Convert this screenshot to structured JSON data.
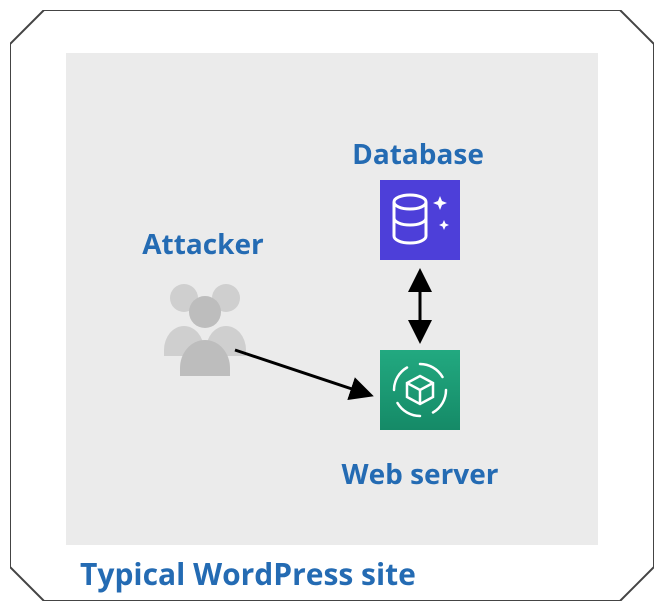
{
  "diagram": {
    "caption": "Typical WordPress site",
    "nodes": {
      "attacker": {
        "label": "Attacker"
      },
      "database": {
        "label": "Database"
      },
      "webserver": {
        "label": "Web server"
      }
    },
    "edges": [
      {
        "from": "attacker",
        "to": "webserver",
        "bidirectional": false
      },
      {
        "from": "database",
        "to": "webserver",
        "bidirectional": true
      }
    ],
    "colors": {
      "accent_text": "#246bb3",
      "database_tile": "#4d3fd9",
      "webserver_tile": "#1a9d75",
      "panel_bg": "#ebebeb"
    }
  }
}
